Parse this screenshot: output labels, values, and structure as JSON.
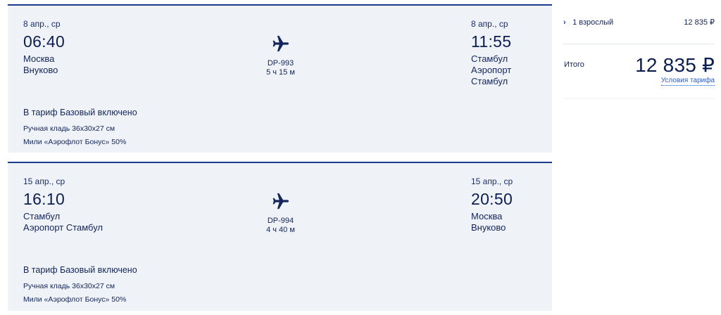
{
  "flights": [
    {
      "departure": {
        "date": "8 апр., ср",
        "time": "06:40",
        "city": "Москва",
        "airport": "Внуково"
      },
      "segment": {
        "flight_number": "DP-993",
        "duration": "5 ч 15 м"
      },
      "arrival": {
        "date": "8 апр., ср",
        "time": "11:55",
        "city": "Стамбул",
        "airport": "Аэропорт Стамбул"
      },
      "tariff": {
        "title": "В тариф Базовый включено",
        "items": [
          "Ручная кладь 36x30x27 см",
          "Мили «Аэрофлот Бонус» 50%"
        ]
      }
    },
    {
      "departure": {
        "date": "15 апр., ср",
        "time": "16:10",
        "city": "Стамбул",
        "airport": "Аэропорт Стамбул"
      },
      "segment": {
        "flight_number": "DP-994",
        "duration": "4 ч 40 м"
      },
      "arrival": {
        "date": "15 апр., ср",
        "time": "20:50",
        "city": "Москва",
        "airport": "Внуково"
      },
      "tariff": {
        "title": "В тариф Базовый включено",
        "items": [
          "Ручная кладь 36x30x27 см",
          "Мили «Аэрофлот Бонус» 50%"
        ]
      }
    }
  ],
  "summary": {
    "passenger_chevron": "›",
    "passenger_label": "1 взрослый",
    "passenger_price": "12 835 ₽",
    "total_label": "Итого",
    "total_price": "12 835 ₽",
    "tariff_conditions_link": "Условия тарифа"
  },
  "icons": {
    "plane": "airplane-icon",
    "chevron": "chevron-right-icon"
  },
  "colors": {
    "card_background": "#eff2f7",
    "card_border": "#1b3a8c",
    "text_primary": "#13255b",
    "link": "#2c5bd8"
  }
}
